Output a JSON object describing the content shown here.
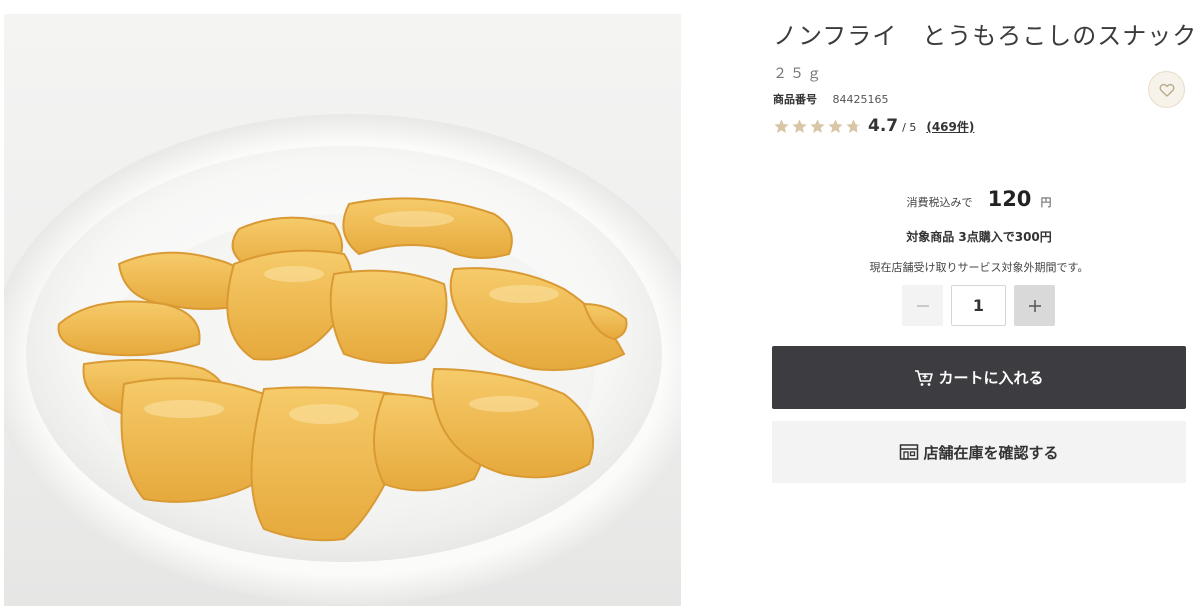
{
  "product": {
    "title": "ノンフライ　とうもろこしのスナック",
    "weight": "２５ｇ",
    "code_label": "商品番号",
    "code": "84425165",
    "image_icon": "product-photo",
    "favorite_icon": "heart-icon"
  },
  "rating": {
    "score": "4.7",
    "max": "/ 5",
    "stars": 4.7,
    "reviews": "(469件)",
    "star_color": "#d8c6a6"
  },
  "price": {
    "prefix": "消費税込みで",
    "value": "120",
    "unit": "円"
  },
  "promo": "対象商品 3点購入で300円",
  "notice": "現在店舗受け取りサービス対象外期間です。",
  "quantity": {
    "value": "1",
    "minus_icon": "minus-icon",
    "plus_icon": "plus-icon"
  },
  "actions": {
    "cart_label": "カートに入れる",
    "cart_icon": "cart-icon",
    "store_label": "店舗在庫を確認する",
    "store_icon": "store-icon"
  },
  "colors": {
    "cart_bg": "#3c3c41",
    "store_bg": "#f3f3f3",
    "favorite_bg": "#f7f2ea"
  }
}
